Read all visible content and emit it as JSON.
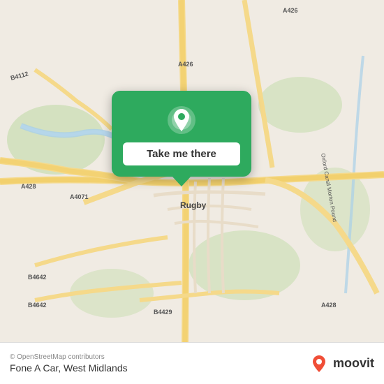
{
  "map": {
    "background_color": "#e8e0d8",
    "center_label": "Rugby"
  },
  "popup": {
    "button_label": "Take me there",
    "background_color": "#2eaa5e"
  },
  "bottom_bar": {
    "copyright": "© OpenStreetMap contributors",
    "location_name": "Fone A Car, West Midlands",
    "moovit_label": "moovit"
  },
  "road_labels": [
    "A426",
    "A428",
    "A4071",
    "B4112",
    "B4642",
    "B4429",
    "Oxford Canal Morton Pound"
  ],
  "icons": {
    "pin": "location-pin-icon",
    "moovit_pin": "moovit-brand-icon"
  }
}
